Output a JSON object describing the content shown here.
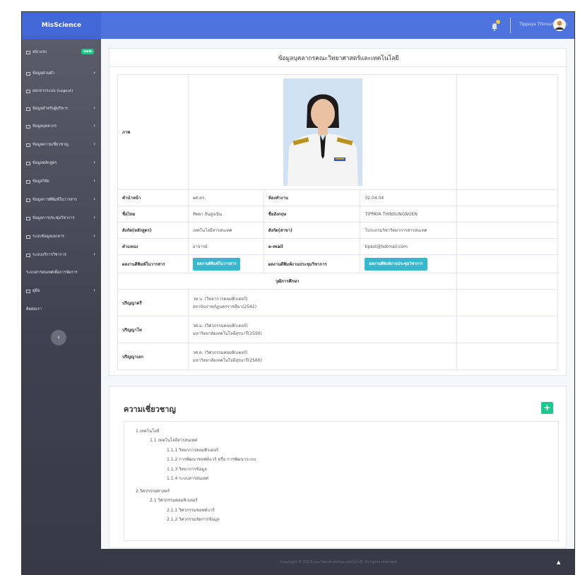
{
  "topbar": {
    "brand": "MisScience",
    "user_name": "Tippaya Thinsungnoen"
  },
  "sidebar": {
    "items": [
      {
        "label": "หน้าแรก",
        "badge": "new"
      },
      {
        "label": "ข้อมูลส่วนตัว"
      },
      {
        "label": "ออกจากระบบ (Logout)"
      },
      {
        "label": "ข้อมูลสำหรับผู้บริหาร"
      },
      {
        "label": "ข้อมูลบุคลากร"
      },
      {
        "label": "ข้อมูลความเชี่ยวชาญ"
      },
      {
        "label": "ข้อมูลหลักสูตร"
      },
      {
        "label": "ข้อมูลวิจัย"
      },
      {
        "label": "ข้อมูลการตีพิมพ์ในวารสาร"
      },
      {
        "label": "ข้อมูลการประชุมวิชาการ"
      },
      {
        "label": "ระบบข้อมูลเอกสาร"
      },
      {
        "label": "ระบบบริการวิชาการ"
      },
      {
        "label": "ระบบสารสนเทศเพื่อการจัดการ"
      },
      {
        "label": "คู่มือ"
      },
      {
        "label": "ติดต่อเรา"
      }
    ]
  },
  "profile": {
    "title": "ข้อมูลบุคลากรคณะวิทยาศาสตร์และเทคโนโลยี",
    "photo_label": "ภาพ",
    "rows": [
      {
        "l1": "คำนำหน้า",
        "v1": "ผศ.ดร.",
        "l2": "ห้องทำงาน",
        "v2": "32.04.04"
      },
      {
        "l1": "ชื่อไทย",
        "v1": "ทิพยา ถินสูงเนิน",
        "l2": "ชื่ออังกฤษ",
        "v2": "TIPPAYA THINSUNGNOEN"
      },
      {
        "l1": "สังกัด(หลักสูตร)",
        "v1": "เทคโนโลยีสารสนเทศ",
        "l2": "สังกัด(สาขา)",
        "v2": "โปรแกรมวิชาวิทยาการสารสนเทศ"
      },
      {
        "l1": "ตำแหน่ง",
        "v1": "อาจารย์",
        "l2": "e-mail",
        "v2": "tipsot@hotmail.com"
      }
    ],
    "journal_label": "ผลงานตีพิมพ์ในวารสาร",
    "journal_button": "ผลงานตีพิมพ์ในวารสาร",
    "conf_label": "ผลงานตีพิมพ์งานประชุมวิชาการ",
    "conf_button": "ผลงานตีพิมพ์งานประชุมวิชาการ",
    "edu_header": "วุฒิการศึกษา",
    "education": [
      {
        "level": "ปริญญาตรี",
        "degree": "วท.บ. (วิทยาการคอมพิวเตอร์)",
        "school": "สถาบันราชภัฏนครราชสีมา(2542)"
      },
      {
        "level": "ปริญญาโท",
        "degree": "วศ.ม. (วิศวกรรมคอมพิวเตอร์)",
        "school": "มหาวิทยาลัยเทคโนโลยีสุรนารี(2550)"
      },
      {
        "level": "ปริญญาเอก",
        "degree": "วศ.ด. (วิศวกรรมคอมพิวเตอร์)",
        "school": "มหาวิทยาลัยเทคโนโลยีสุรนารี(2560)"
      }
    ]
  },
  "expertise": {
    "title": "ความเชี่ยวชาญ",
    "add_button": "+",
    "lines": [
      "1.เทคโนโลยี",
      "1.1 เทคโนโลยีสารสนเทศ",
      "1.1.1 วิทยาการคอมพิวเตอร์",
      "1.1.2 การพัฒนาซอฟต์แวร์ หรือ การพัฒนาระบบ",
      "1.1.3 วิทยาการข้อมูล",
      "1.1.4 ระบบสารสนเทศ",
      "2.วิศวกรรมศาสตร์",
      "2.1 วิศวกรรมคอมพิวเตอร์",
      "2.1.1 วิศวกรรมซอฟต์แวร์",
      "2.1.2 วิศวกรรมจัดการข้อมูล"
    ]
  },
  "footer": {
    "text": "Copyright © 2023 คณะวิทยาศาสตร์และเทคโนโลยี. All rights reserved"
  }
}
